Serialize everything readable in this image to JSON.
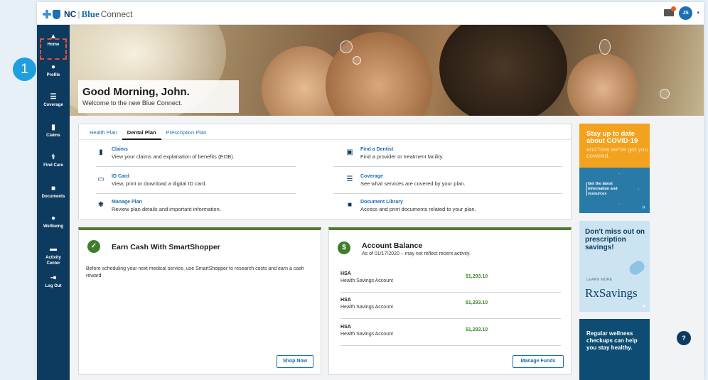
{
  "brand": {
    "nc": "NC",
    "blue": "Blue",
    "connect": "Connect"
  },
  "header": {
    "avatar_initials": "JS"
  },
  "sidebar": {
    "items": [
      {
        "label": "Home",
        "icon": "home-icon"
      },
      {
        "label": "Profile",
        "icon": "profile-icon"
      },
      {
        "label": "Coverage",
        "icon": "list-icon"
      },
      {
        "label": "Claims",
        "icon": "claims-icon"
      },
      {
        "label": "Find Care",
        "icon": "stethoscope-icon"
      },
      {
        "label": "Documents",
        "icon": "folder-icon"
      },
      {
        "label": "Wellbeing",
        "icon": "apple-icon"
      },
      {
        "label": "Activity Center",
        "icon": "card-icon"
      },
      {
        "label": "Log Out",
        "icon": "logout-icon"
      }
    ],
    "callout_number": "1"
  },
  "hero": {
    "greeting": "Good Morning, John.",
    "subtitle": "Welcome to the new Blue Connect."
  },
  "plans": {
    "tabs": [
      {
        "label": "Health Plan",
        "active": false
      },
      {
        "label": "Dental Plan",
        "active": true
      },
      {
        "label": "Prescription Plan",
        "active": false
      }
    ],
    "links": [
      {
        "title": "Claims",
        "desc": "View your claims and explanation of benefits (EOB)."
      },
      {
        "title": "Find a Dentist",
        "desc": "Find a provider or treatment facility."
      },
      {
        "title": "ID Card",
        "desc": "View, print or download a digital ID card."
      },
      {
        "title": "Coverage",
        "desc": "See what services are covered by your plan."
      },
      {
        "title": "Manage Plan",
        "desc": "Review plan details and important information."
      },
      {
        "title": "Document Library",
        "desc": "Access and print documents related to your plan."
      }
    ]
  },
  "smartshopper": {
    "title": "Earn Cash With SmartShopper",
    "body": "Before scheduling your next medical service, use SmartShopper to research costs and earn a cash reward.",
    "button": "Shop Now"
  },
  "account": {
    "title": "Account Balance",
    "subtitle": "As of 01/17/2020 – may not reflect recent activity.",
    "icon_glyph": "$",
    "rows": [
      {
        "type": "HSA",
        "name": "Health Savings Account",
        "amount": "$1,293.10"
      },
      {
        "type": "HSA",
        "name": "Health Savings Account",
        "amount": "$1,293.10"
      },
      {
        "type": "HSA",
        "name": "Health Savings Account",
        "amount": "$1,293.10"
      }
    ],
    "button": "Manage Funds"
  },
  "ads": {
    "covid": {
      "line1": "Stay up to date about COVID-19",
      "line2": "and how we've got you covered.",
      "cta": "Get the latest information and resources"
    },
    "rx": {
      "line1": "Don't miss out on prescription savings!",
      "learn": "LEARN MORE",
      "brand": "RxSavings"
    },
    "wellness": {
      "line1": "Regular wellness checkups can help you stay healthy."
    }
  },
  "help": {
    "glyph": "?"
  },
  "colors": {
    "navy": "#0d3a5f",
    "link": "#1a6fb5",
    "green": "#4d7c2f",
    "orange": "#f2a21e"
  }
}
